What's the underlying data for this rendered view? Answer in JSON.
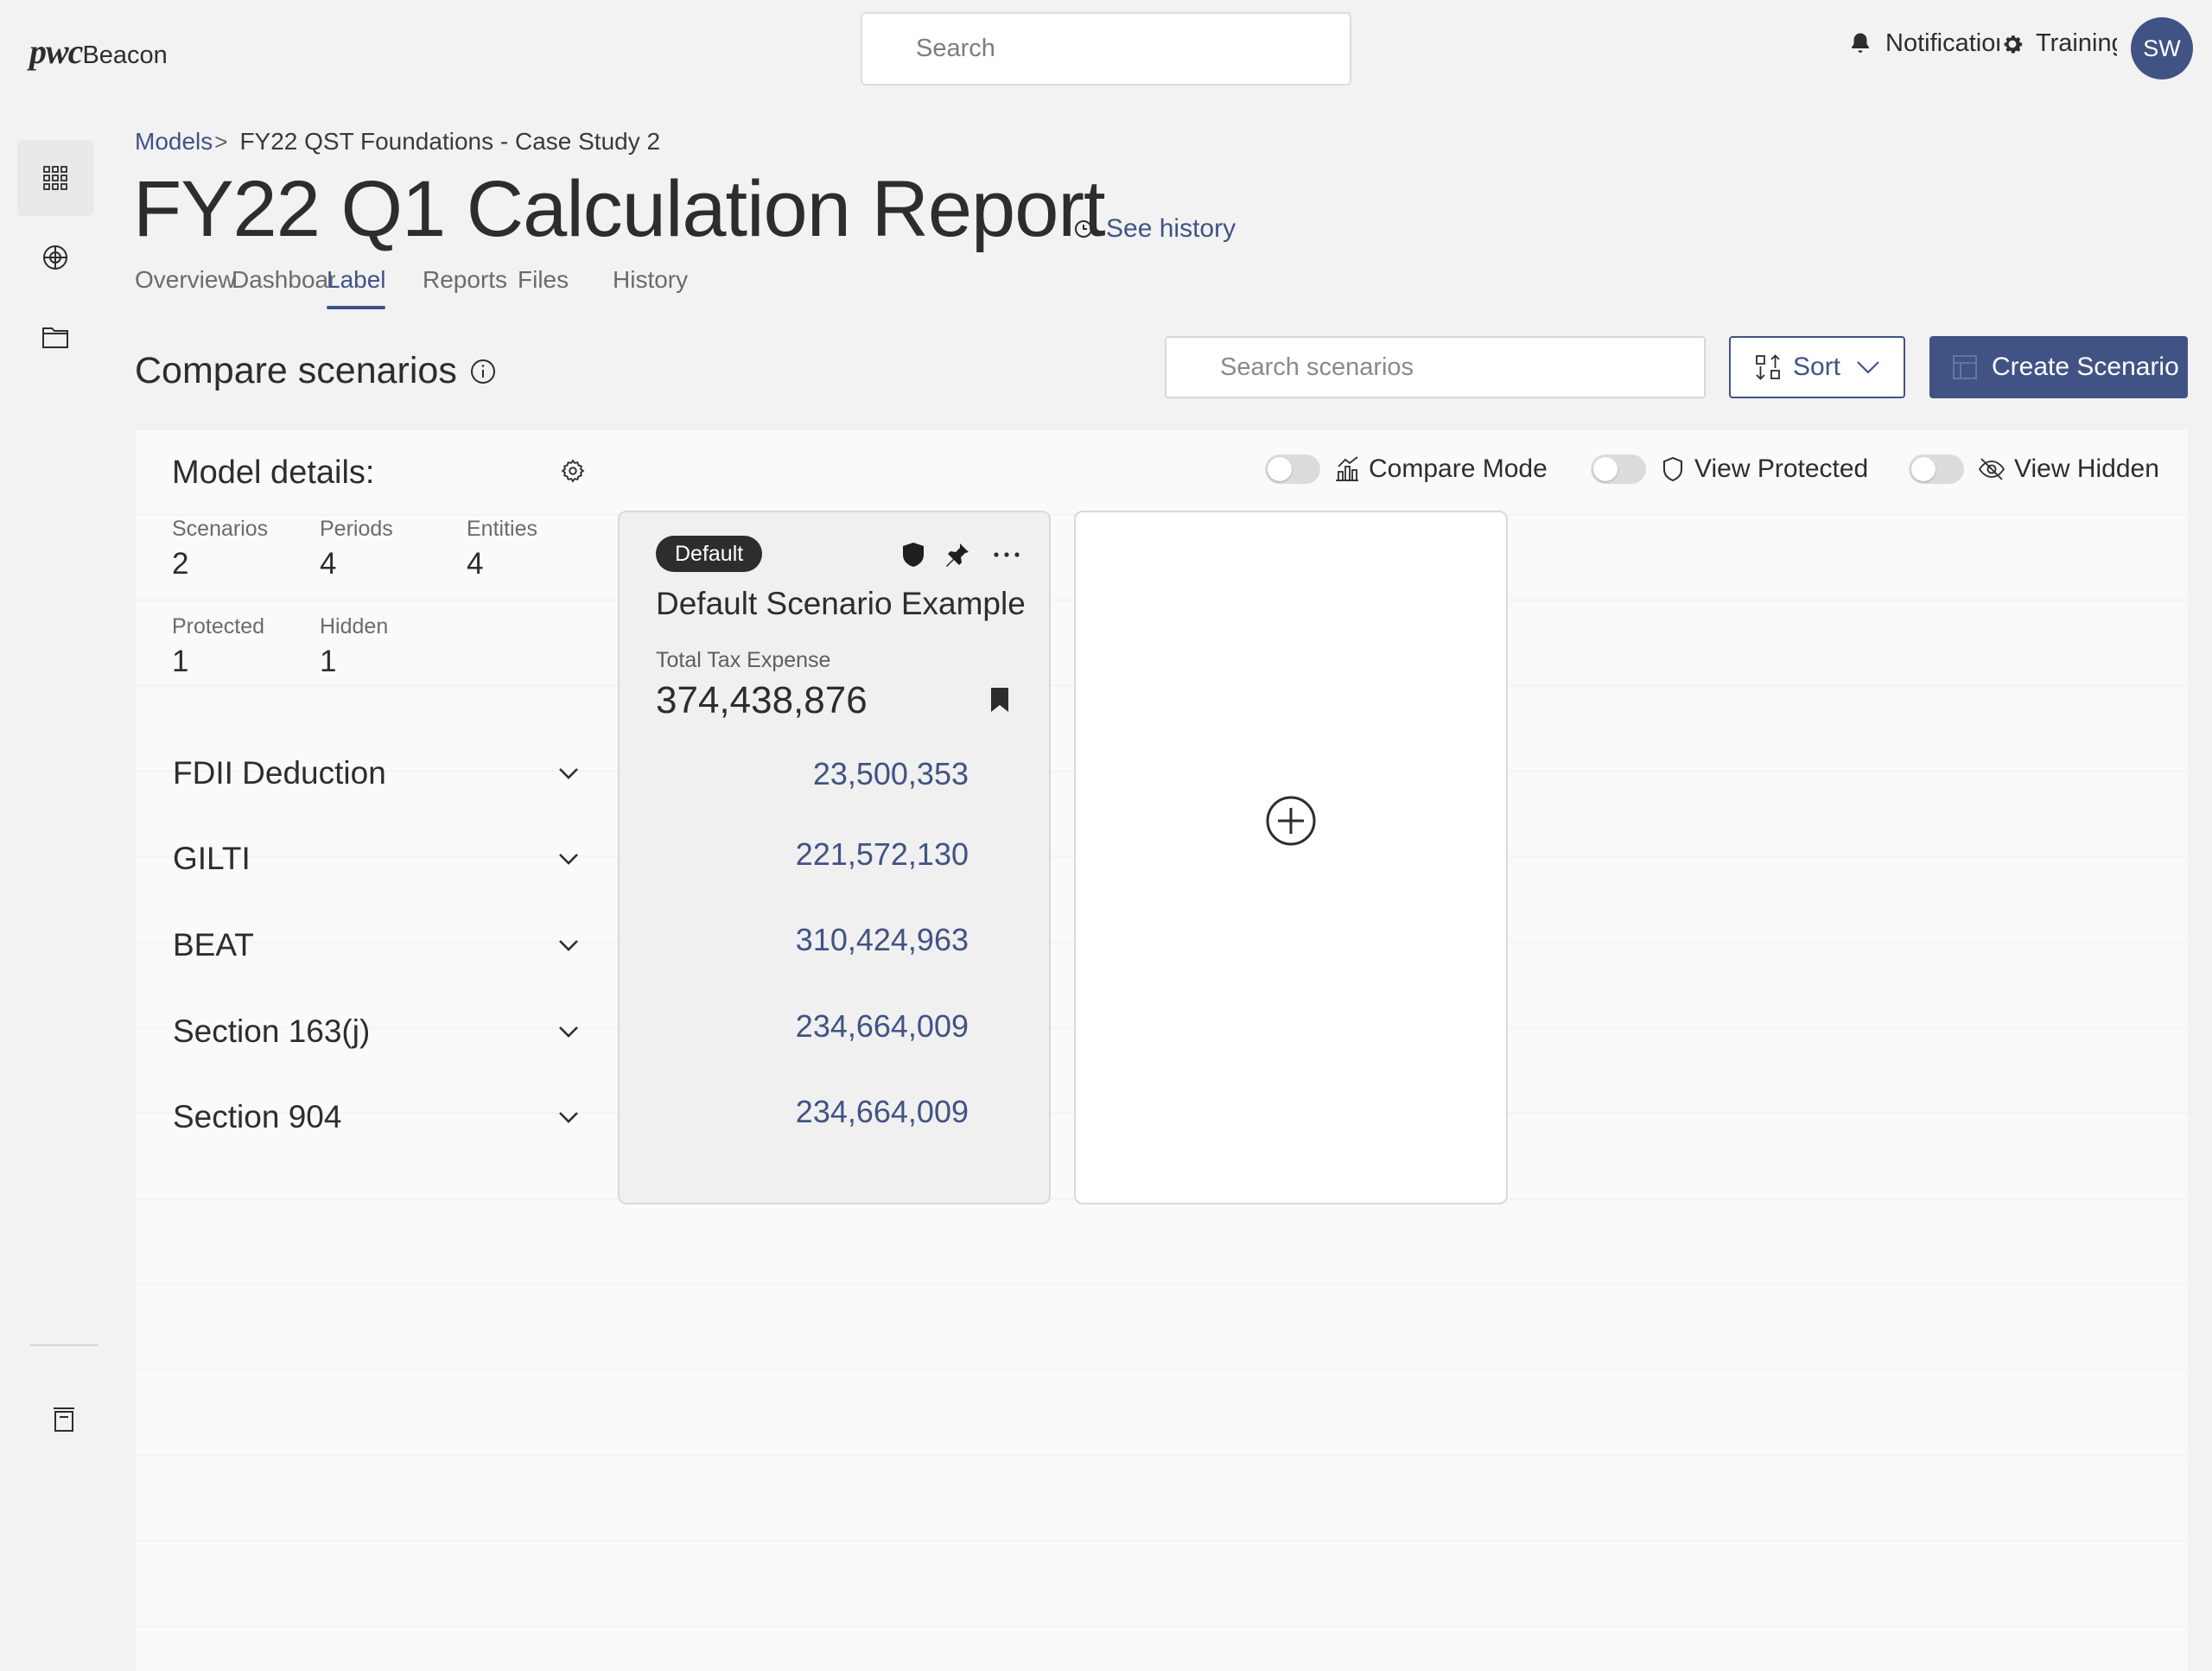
{
  "app": {
    "logo_brand": "pwc",
    "logo_app": "Beacon",
    "search_placeholder": "Search"
  },
  "header_right": {
    "notifications_label": "Notifications",
    "training_label": "Training",
    "avatar_initials": "SW"
  },
  "breadcrumb": {
    "root": "Models",
    "separator": ">",
    "current": "FY22 QST Foundations - Case Study 2"
  },
  "page": {
    "title": "FY22 Q1 Calculation Report",
    "history_link": "See history"
  },
  "tabs": [
    {
      "label": "Overview"
    },
    {
      "label": "Dashboard"
    },
    {
      "label": "Label"
    },
    {
      "label": "Reports"
    },
    {
      "label": "Files"
    },
    {
      "label": "History"
    }
  ],
  "toolbar": {
    "section_title": "Compare scenarios",
    "scenario_search_placeholder": "Search scenarios",
    "sort_label": "Sort",
    "create_label": "Create Scenario"
  },
  "model_details": {
    "title": "Model details:",
    "stats": [
      {
        "label": "Scenarios",
        "value": "2"
      },
      {
        "label": "Periods",
        "value": "4"
      },
      {
        "label": "Entities",
        "value": "4"
      },
      {
        "label": "Protected",
        "value": "1"
      },
      {
        "label": "Hidden",
        "value": "1"
      }
    ],
    "sections": [
      {
        "label": "FDII Deduction"
      },
      {
        "label": "GILTI"
      },
      {
        "label": "BEAT"
      },
      {
        "label": "Section 163(j)"
      },
      {
        "label": "Section 904"
      }
    ]
  },
  "toggles": {
    "compare_mode": "Compare Mode",
    "view_protected": "View Protected",
    "view_hidden": "View Hidden"
  },
  "scenario_card": {
    "badge": "Default",
    "title": "Default Scenario Example",
    "total_label": "Total Tax Expense",
    "total_value": "374,438,876",
    "values": [
      "23,500,353",
      "221,572,130",
      "310,424,963",
      "234,664,009",
      "234,664,009"
    ]
  },
  "icons": {
    "rail": [
      "grid-icon",
      "target-icon",
      "folder-icon",
      "trash-icon"
    ],
    "accent_color": "#415385"
  }
}
